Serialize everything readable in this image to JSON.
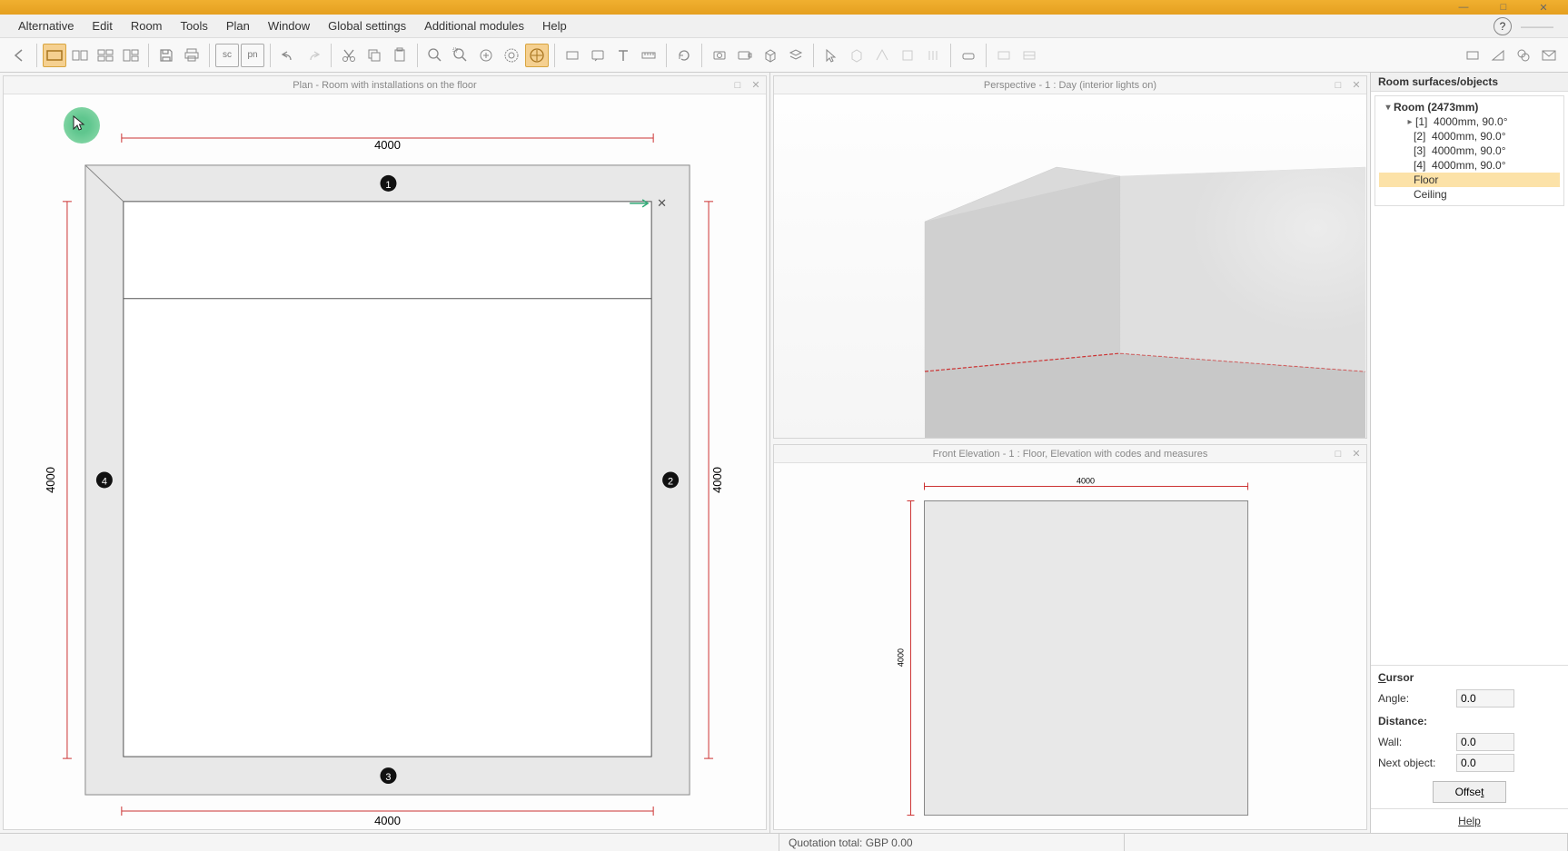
{
  "menu": {
    "items": [
      "Alternative",
      "Edit",
      "Room",
      "Tools",
      "Plan",
      "Window",
      "Global settings",
      "Additional modules",
      "Help"
    ]
  },
  "panels": {
    "plan": {
      "title": "Plan - Room with installations on the floor"
    },
    "perspective": {
      "title": "Perspective - 1 : Day (interior lights on)"
    },
    "elevation": {
      "title": "Front Elevation - 1 : Floor, Elevation with codes and measures"
    }
  },
  "plan": {
    "dim_top": "4000",
    "dim_bottom": "4000",
    "dim_left": "4000",
    "dim_right": "4000",
    "wall_labels": [
      "1",
      "2",
      "3",
      "4"
    ]
  },
  "elevation": {
    "dim_top": "4000",
    "dim_left": "4000"
  },
  "sidebar": {
    "title": "Room surfaces/objects",
    "room_label": "Room (2473mm)",
    "walls": [
      {
        "idx": "[1]",
        "value": "4000mm, 90.0°"
      },
      {
        "idx": "[2]",
        "value": "4000mm, 90.0°"
      },
      {
        "idx": "[3]",
        "value": "4000mm, 90.0°"
      },
      {
        "idx": "[4]",
        "value": "4000mm, 90.0°"
      }
    ],
    "floor": "Floor",
    "ceiling": "Ceiling"
  },
  "cursor": {
    "title": "Cursor",
    "angle_label": "Angle:",
    "angle_value": "0.0",
    "distance_label": "Distance:",
    "wall_label": "Wall:",
    "wall_value": "0.0",
    "next_label": "Next object:",
    "next_value": "0.0",
    "offset_label": "Offset"
  },
  "help_link": "Help",
  "status": {
    "quotation": "Quotation total: GBP 0.00"
  }
}
